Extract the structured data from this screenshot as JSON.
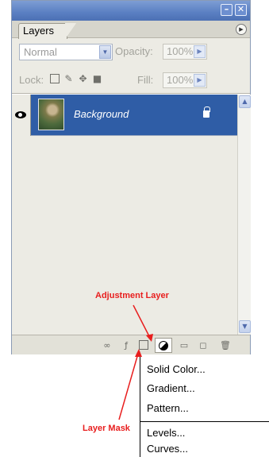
{
  "panel": {
    "tab_label": "Layers",
    "blend_mode": "Normal",
    "opacity_label": "Opacity:",
    "opacity_value": "100%",
    "lock_label": "Lock:",
    "fill_label": "Fill:",
    "fill_value": "100%"
  },
  "layers": [
    {
      "name": "Background",
      "visible": true,
      "locked": true,
      "selected": true
    }
  ],
  "menu": {
    "items": [
      "Solid Color...",
      "Gradient...",
      "Pattern...",
      "Levels...",
      "Curves..."
    ]
  },
  "annotations": {
    "adjustment": "Adjustment Layer",
    "mask": "Layer Mask"
  },
  "colors": {
    "selection": "#2f5da6",
    "annotation": "#e81e1e",
    "titlebar": "#5a7fc2"
  },
  "icons": [
    "minimize-icon",
    "close-icon",
    "panel-menu-icon",
    "eye-icon",
    "lock-icon",
    "link-icon",
    "layer-style-icon",
    "layer-mask-icon",
    "adjustment-layer-icon",
    "new-group-icon",
    "new-layer-icon",
    "trash-icon"
  ]
}
